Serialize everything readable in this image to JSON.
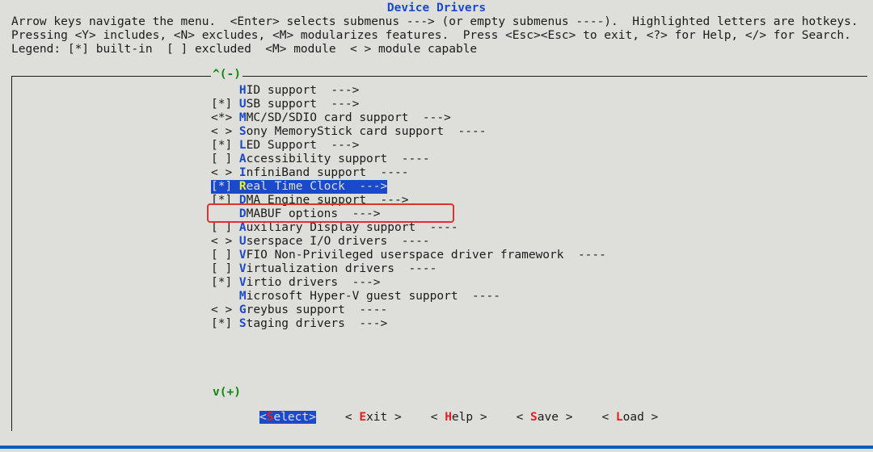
{
  "title": "Device Drivers",
  "help_text": "Arrow keys navigate the menu.  <Enter> selects submenus ---> (or empty submenus ----).  Highlighted letters are hotkeys.\nPressing <Y> includes, <N> excludes, <M> modularizes features.  Press <Esc><Esc> to exit, <?> for Help, </> for Search.\nLegend: [*] built-in  [ ] excluded  <M> module  < > module capable",
  "scroll_up": "^(-)",
  "scroll_down": "v(+)",
  "items": [
    {
      "prefix": "    ",
      "hotkey": "H",
      "label": "ID support  --->",
      "selected": false
    },
    {
      "prefix": "[*] ",
      "hotkey": "U",
      "label": "SB support  --->",
      "selected": false
    },
    {
      "prefix": "<*> ",
      "hotkey": "M",
      "label": "MC/SD/SDIO card support  --->",
      "selected": false
    },
    {
      "prefix": "< > ",
      "hotkey": "S",
      "label": "ony MemoryStick card support  ----",
      "selected": false
    },
    {
      "prefix": "[*] ",
      "hotkey": "L",
      "label": "ED Support  --->",
      "selected": false
    },
    {
      "prefix": "[ ] ",
      "hotkey": "A",
      "label": "ccessibility support  ----",
      "selected": false
    },
    {
      "prefix": "< > ",
      "hotkey": "I",
      "label": "nfiniBand support  ----",
      "selected": false
    },
    {
      "prefix": "[*] ",
      "hotkey": "R",
      "label": "eal Time Clock  --->",
      "selected": true
    },
    {
      "prefix": "[*] ",
      "hotkey": "D",
      "label": "MA Engine support  --->",
      "selected": false
    },
    {
      "prefix": "    ",
      "hotkey": "D",
      "label": "MABUF options  --->",
      "selected": false
    },
    {
      "prefix": "[ ] ",
      "hotkey": "A",
      "label": "uxiliary Display support  ----",
      "selected": false
    },
    {
      "prefix": "< > ",
      "hotkey": "U",
      "label": "serspace I/O drivers  ----",
      "selected": false
    },
    {
      "prefix": "[ ] ",
      "hotkey": "V",
      "label": "FIO Non-Privileged userspace driver framework  ----",
      "selected": false
    },
    {
      "prefix": "[ ] ",
      "hotkey": "V",
      "label": "irtualization drivers  ----",
      "selected": false
    },
    {
      "prefix": "[*] ",
      "hotkey": "V",
      "label": "irtio drivers  --->",
      "selected": false
    },
    {
      "prefix": "    ",
      "hotkey": "M",
      "label": "icrosoft Hyper-V guest support  ----",
      "selected": false
    },
    {
      "prefix": "< > ",
      "hotkey": "G",
      "label": "reybus support  ----",
      "selected": false
    },
    {
      "prefix": "[*] ",
      "hotkey": "S",
      "label": "taging drivers  --->",
      "selected": false
    }
  ],
  "buttons": [
    {
      "left": "<",
      "hk": "S",
      "rest": "elect>",
      "active": true
    },
    {
      "left": "< ",
      "hk": "E",
      "rest": "xit >",
      "active": false
    },
    {
      "left": "< ",
      "hk": "H",
      "rest": "elp >",
      "active": false
    },
    {
      "left": "< ",
      "hk": "S",
      "rest": "ave >",
      "active": false
    },
    {
      "left": "< ",
      "hk": "L",
      "rest": "oad >",
      "active": false
    }
  ]
}
